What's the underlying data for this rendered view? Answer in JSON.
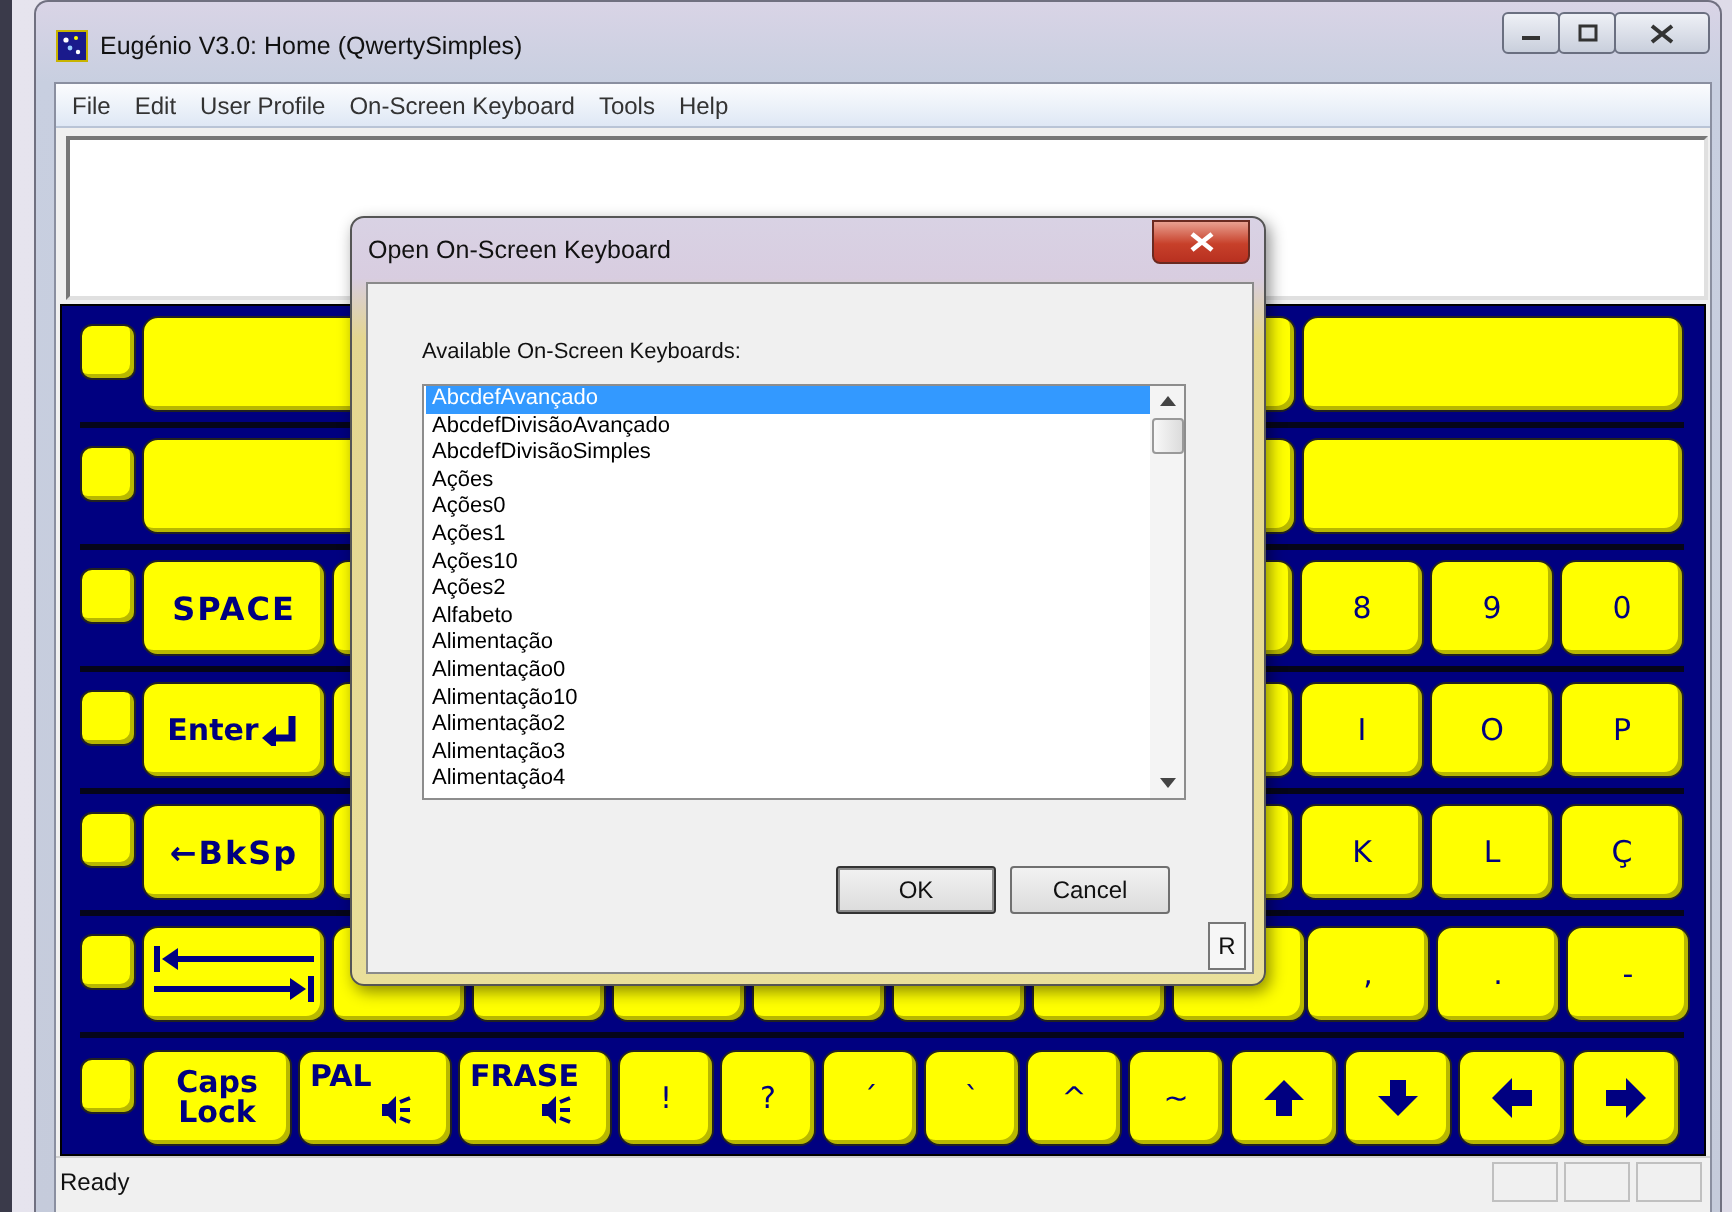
{
  "window": {
    "title": "Eugénio V3.0: Home (QwertySimples)"
  },
  "menu": [
    {
      "label": "File"
    },
    {
      "label": "Edit"
    },
    {
      "label": "User Profile"
    },
    {
      "label": "On-Screen Keyboard"
    },
    {
      "label": "Tools"
    },
    {
      "label": "Help"
    }
  ],
  "keyboard": {
    "rows": [
      {
        "left": [
          {
            "kind": "square"
          },
          {
            "kind": "wide"
          }
        ],
        "right": [
          {
            "kind": "blank"
          },
          {
            "kind": "wide"
          }
        ]
      },
      {
        "left": [
          {
            "kind": "square"
          },
          {
            "kind": "wide"
          }
        ],
        "right": [
          {
            "kind": "blank"
          },
          {
            "kind": "wide"
          }
        ]
      },
      {
        "left": [
          {
            "kind": "square"
          },
          {
            "kind": "special",
            "label": "SPACE"
          },
          {
            "kind": "blank"
          }
        ],
        "right": [
          {
            "kind": "blank"
          },
          {
            "kind": "char",
            "label": "8"
          },
          {
            "kind": "char",
            "label": "9"
          },
          {
            "kind": "char",
            "label": "0"
          }
        ]
      },
      {
        "left": [
          {
            "kind": "square"
          },
          {
            "kind": "enter",
            "label": "Enter"
          },
          {
            "kind": "blank"
          }
        ],
        "right": [
          {
            "kind": "blank"
          },
          {
            "kind": "char",
            "label": "I"
          },
          {
            "kind": "char",
            "label": "O"
          },
          {
            "kind": "char",
            "label": "P"
          }
        ]
      },
      {
        "left": [
          {
            "kind": "square"
          },
          {
            "kind": "special",
            "label": "←BkSp"
          },
          {
            "kind": "blank"
          }
        ],
        "right": [
          {
            "kind": "blank"
          },
          {
            "kind": "char",
            "label": "K"
          },
          {
            "kind": "char",
            "label": "L"
          },
          {
            "kind": "char",
            "label": "Ç"
          }
        ]
      },
      {
        "left": [
          {
            "kind": "square"
          },
          {
            "kind": "tab"
          },
          {
            "kind": "blank"
          },
          {
            "kind": "blank"
          },
          {
            "kind": "blank"
          },
          {
            "kind": "blank"
          },
          {
            "kind": "blank"
          },
          {
            "kind": "blank"
          },
          {
            "kind": "blank"
          }
        ],
        "right": [
          {
            "kind": "char",
            "label": ","
          },
          {
            "kind": "char",
            "label": "."
          },
          {
            "kind": "char",
            "label": "-"
          }
        ]
      },
      {
        "left": [
          {
            "kind": "square"
          },
          {
            "kind": "caps",
            "label": "Caps Lock"
          },
          {
            "kind": "speak",
            "label": "PAL"
          },
          {
            "kind": "speak",
            "label": "FRASE"
          },
          {
            "kind": "punct",
            "label": "!"
          },
          {
            "kind": "punct",
            "label": "?"
          },
          {
            "kind": "punct",
            "label": "´"
          },
          {
            "kind": "punct",
            "label": "`"
          },
          {
            "kind": "punct",
            "label": "^"
          },
          {
            "kind": "punct",
            "label": "~"
          },
          {
            "kind": "up"
          },
          {
            "kind": "down"
          },
          {
            "kind": "left"
          },
          {
            "kind": "right"
          }
        ],
        "right": []
      }
    ]
  },
  "dialog": {
    "title": "Open On-Screen Keyboard",
    "label": "Available On-Screen Keyboards:",
    "items": [
      {
        "label": "AbcdefAvançado",
        "selected": true
      },
      {
        "label": "AbcdefDivisãoAvançado",
        "selected": false
      },
      {
        "label": "AbcdefDivisãoSimples",
        "selected": false
      },
      {
        "label": "Ações",
        "selected": false
      },
      {
        "label": "Ações0",
        "selected": false
      },
      {
        "label": "Ações1",
        "selected": false
      },
      {
        "label": "Ações10",
        "selected": false
      },
      {
        "label": "Ações2",
        "selected": false
      },
      {
        "label": "Alfabeto",
        "selected": false
      },
      {
        "label": "Alimentação",
        "selected": false
      },
      {
        "label": "Alimentação0",
        "selected": false
      },
      {
        "label": "Alimentação10",
        "selected": false
      },
      {
        "label": "Alimentação2",
        "selected": false
      },
      {
        "label": "Alimentação3",
        "selected": false
      },
      {
        "label": "Alimentação4",
        "selected": false
      }
    ],
    "buttons": [
      {
        "label": "OK",
        "kind": "default"
      },
      {
        "label": "Cancel",
        "kind": "normal"
      }
    ],
    "corner_button": "R"
  },
  "status_bar": {
    "text": "Ready"
  }
}
